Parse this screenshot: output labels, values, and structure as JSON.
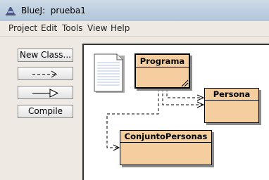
{
  "window": {
    "title": "BlueJ:  prueba1"
  },
  "menu": [
    "Project",
    "Edit",
    "Tools",
    "View",
    "Help"
  ],
  "toolbar": {
    "new_class_label": "New Class...",
    "compile_label": "Compile"
  },
  "diagram": {
    "classes": [
      {
        "name": "Programa"
      },
      {
        "name": "Persona"
      },
      {
        "name": "ConjuntoPersonas"
      }
    ]
  }
}
